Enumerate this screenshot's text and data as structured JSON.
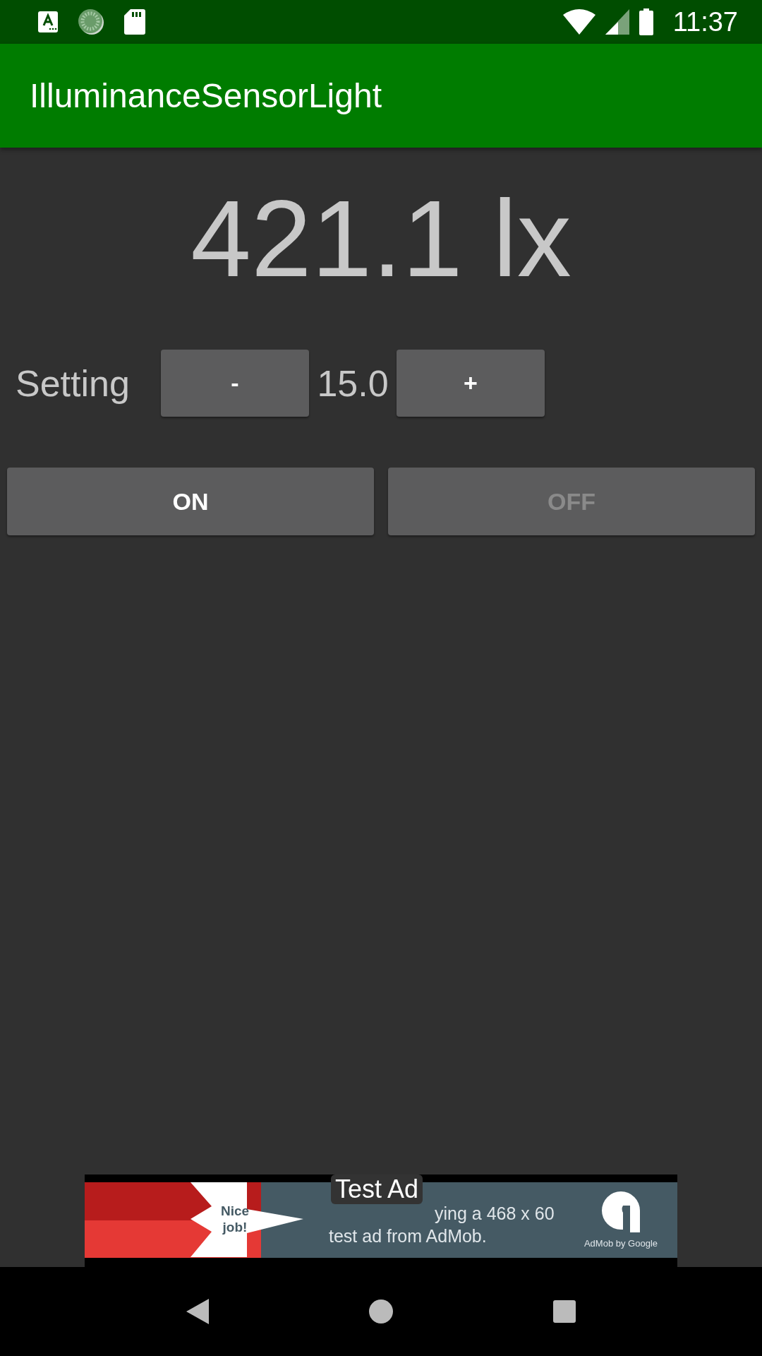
{
  "status_bar": {
    "time": "11:37"
  },
  "app_bar": {
    "title": "IlluminanceSensorLight"
  },
  "reading": "421.1 lx",
  "setting": {
    "label": "Setting",
    "decrease": "-",
    "value": "15.0",
    "increase": "+"
  },
  "buttons": [
    {
      "label": "ON",
      "disabled": false
    },
    {
      "label": "OFF",
      "disabled": true
    }
  ],
  "ad": {
    "badge": "Test Ad",
    "star_text": "Nice job!",
    "message_line_1": "ying a 468 x 60",
    "message_line_2": "test ad from AdMob.",
    "brand": "AdMob by Google"
  }
}
